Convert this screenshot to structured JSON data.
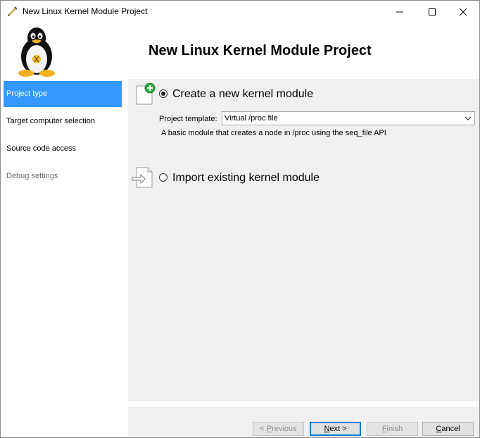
{
  "window": {
    "title": "New Linux Kernel Module Project"
  },
  "header": {
    "title": "New Linux Kernel Module Project"
  },
  "sidebar": {
    "items": [
      {
        "label": "Project type",
        "state": "selected"
      },
      {
        "label": "Target computer selection",
        "state": "normal"
      },
      {
        "label": "Source code access",
        "state": "normal"
      },
      {
        "label": "Debug settings",
        "state": "disabled"
      }
    ]
  },
  "main": {
    "create_option": {
      "label": "Create a new kernel module",
      "checked": true
    },
    "template_label": "Project template:",
    "template_value": "Virtual /proc file",
    "template_description": "A basic module that creates a node in /proc using the seq_file API",
    "import_option": {
      "label": "Import existing kernel module",
      "checked": false
    }
  },
  "footer": {
    "previous": {
      "prefix": "< ",
      "accel": "P",
      "rest": "revious"
    },
    "next": {
      "accel": "N",
      "rest": "ext >"
    },
    "finish": {
      "accel": "F",
      "rest": "inish"
    },
    "cancel": {
      "accel": "C",
      "rest": "ancel"
    }
  },
  "colors": {
    "selection": "#3399ff",
    "panel": "#f0f0f0",
    "focus": "#0078d7",
    "plus_badge": "#2db03c"
  },
  "icons": [
    "tux-logo-icon",
    "app-pencil-icon",
    "minimize-icon",
    "maximize-icon",
    "close-icon",
    "new-document-plus-icon",
    "import-document-icon",
    "chevron-down-icon"
  ]
}
